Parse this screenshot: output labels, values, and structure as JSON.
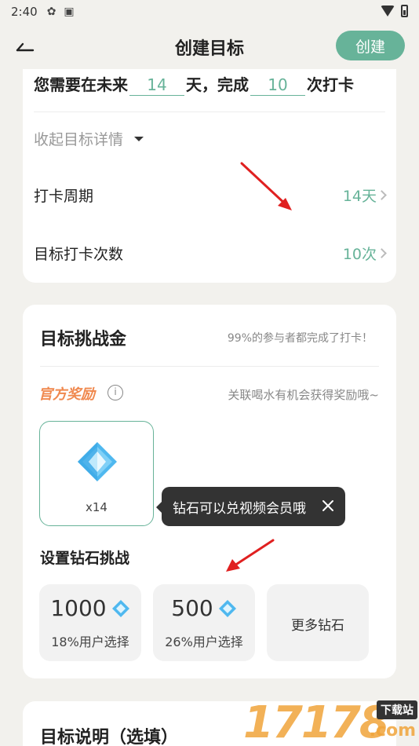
{
  "status_bar": {
    "time": "2:40"
  },
  "header": {
    "title": "创建目标",
    "create_label": "创建"
  },
  "goal_summary": {
    "prefix": "您需要在未来",
    "days_value": "14",
    "middle": "天，完成",
    "count_value": "10",
    "suffix": "次打卡"
  },
  "details": {
    "collapse_label": "收起目标详情",
    "rows": [
      {
        "label": "打卡周期",
        "value": "14天"
      },
      {
        "label": "目标打卡次数",
        "value": "10次"
      }
    ]
  },
  "challenge": {
    "title": "目标挑战金",
    "note": "99%的参与者都完成了打卡！",
    "official_label": "官方奖励",
    "info_glyph": "i",
    "reward_hint": "关联喝水有机会获得奖励哦~",
    "reward_count": "x14",
    "tooltip": "钻石可以兑视频会员哦",
    "set_title": "设置钻石挑战",
    "options": [
      {
        "amount": "1000",
        "percent": "18%用户选择"
      },
      {
        "amount": "500",
        "percent": "26%用户选择"
      }
    ],
    "more_label": "更多钻石"
  },
  "description": {
    "title": "目标说明（选填）"
  },
  "watermark": {
    "digits": "17178",
    "tag": "下载站",
    "domain": ".com"
  },
  "colors": {
    "accent": "#67b399",
    "orange": "#f0894f",
    "diamond": "#4fb8ef"
  }
}
